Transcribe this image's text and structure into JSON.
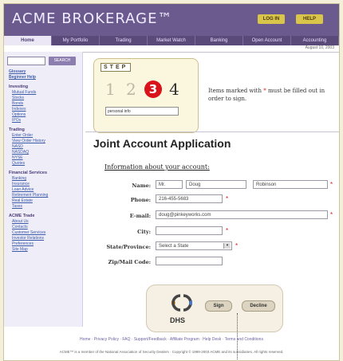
{
  "header": {
    "brand": "ACME BROKERAGE™",
    "log_in": "LOG IN",
    "help": "HELP",
    "date": "August 10, 2003"
  },
  "tabs": [
    {
      "label": "Home",
      "active": true
    },
    {
      "label": "My Portfolio",
      "active": false
    },
    {
      "label": "Trading",
      "active": false
    },
    {
      "label": "Market Watch",
      "active": false
    },
    {
      "label": "Banking",
      "active": false
    },
    {
      "label": "Open Account",
      "active": false
    },
    {
      "label": "Accounting",
      "active": false
    }
  ],
  "sidebar": {
    "search_button": "SEARCH",
    "nav": [
      {
        "type": "p",
        "label": "Glossary"
      },
      {
        "type": "p",
        "label": "Beginner Help"
      },
      {
        "type": "h",
        "label": "Investing"
      },
      {
        "type": "i",
        "label": "Mutual Funds"
      },
      {
        "type": "i",
        "label": "Stocks"
      },
      {
        "type": "i",
        "label": "Bonds"
      },
      {
        "type": "i",
        "label": "Indexes"
      },
      {
        "type": "i",
        "label": "Options"
      },
      {
        "type": "i",
        "label": "IPOs"
      },
      {
        "type": "h",
        "label": "Trading"
      },
      {
        "type": "i",
        "label": "Enter Order"
      },
      {
        "type": "i",
        "label": "View Order History"
      },
      {
        "type": "i",
        "label": "NASD"
      },
      {
        "type": "i",
        "label": "NASDAQ"
      },
      {
        "type": "i",
        "label": "NYSE"
      },
      {
        "type": "i",
        "label": "Quotes"
      },
      {
        "type": "h",
        "label": "Financial Services"
      },
      {
        "type": "i",
        "label": "Banking"
      },
      {
        "type": "i",
        "label": "Insurance"
      },
      {
        "type": "i",
        "label": "Loan Advice"
      },
      {
        "type": "i",
        "label": "Retirement Planning"
      },
      {
        "type": "i",
        "label": "Real Estate"
      },
      {
        "type": "i",
        "label": "Taxes"
      },
      {
        "type": "h",
        "label": "ACME Trade"
      },
      {
        "type": "i",
        "label": "About Us"
      },
      {
        "type": "i",
        "label": "Contacts"
      },
      {
        "type": "i",
        "label": "Customer Services"
      },
      {
        "type": "i",
        "label": "Investor Relations"
      },
      {
        "type": "i",
        "label": "Preferences"
      },
      {
        "type": "i",
        "label": "Site Map"
      }
    ]
  },
  "step": {
    "label": "STEP",
    "numbers": [
      "1",
      "2",
      "3",
      "4"
    ],
    "current": "3",
    "box_text": "personal info"
  },
  "required_note": {
    "before": "Items marked with",
    "star": "*",
    "after": "must be filled out in order to sign."
  },
  "form": {
    "title": "Joint Account Application",
    "section": "Information about your account:",
    "labels": {
      "name": "Name:",
      "phone": "Phone:",
      "email": "E-mail:",
      "city": "City:",
      "state": "State/Province:",
      "zip": "Zip/Mail Code:"
    },
    "values": {
      "prefix": "Mr.",
      "first": "Doug",
      "last": "Robinson",
      "phone": "216-455-5683",
      "email": "doug@pinkeyworks.com",
      "city": "",
      "state": "Select a State",
      "zip": ""
    },
    "star": "*"
  },
  "bottom": {
    "logo_text": "DHS",
    "sign_label": "Sign",
    "decline_label": "Decline"
  },
  "footer": {
    "links": "Home · Privacy Policy · FAQ · Support/Feedback · Affiliate Program · Help Desk · Terms and Conditions",
    "legal": "ACME™ is a member of the National Association of Security Dealers · Copyright © 1999-2003 ACME and its subsidiaries. All rights reserved."
  }
}
